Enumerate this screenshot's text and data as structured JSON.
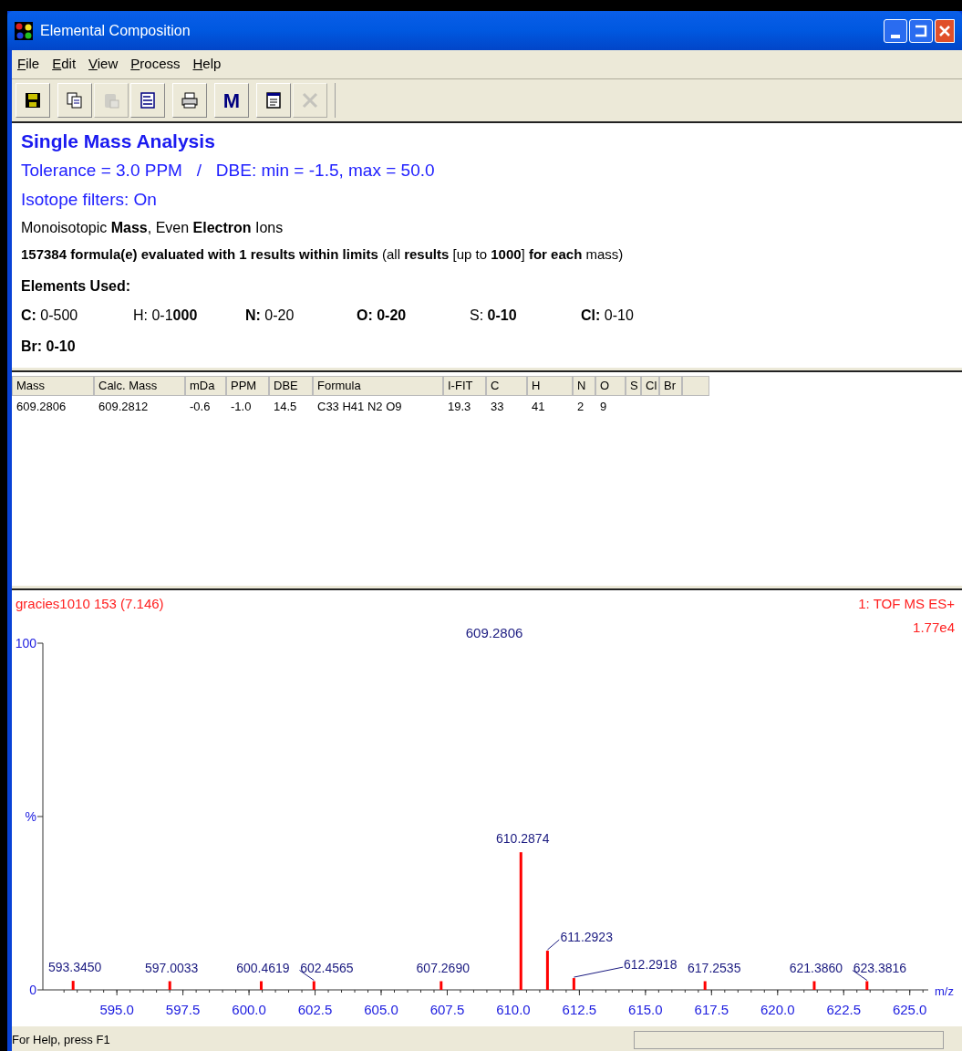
{
  "window": {
    "title": "Elemental Composition"
  },
  "menu": [
    "File",
    "Edit",
    "View",
    "Process",
    "Help"
  ],
  "toolbar": [
    {
      "kind": "save",
      "disabled": false
    },
    {
      "kind": "copy",
      "disabled": false
    },
    {
      "kind": "paste",
      "disabled": true
    },
    {
      "kind": "properties",
      "disabled": false
    },
    {
      "kind": "print",
      "disabled": false
    },
    {
      "kind": "letter",
      "label": "M",
      "disabled": false
    },
    {
      "kind": "document",
      "disabled": false
    },
    {
      "kind": "cross",
      "disabled": true
    }
  ],
  "summary": {
    "title": "Single Mass Analysis",
    "tolerance": "Tolerance = 3.0 PPM   /   DBE: min = -1.5, max = 50.0",
    "isotope": "Isotope filters: On",
    "mode": "Monoisotopic **Mass**, Even **Electron** Ions",
    "evaluated": "**157384 formula(e) evaluated with 1 results within limits** (all **results** [up to **1000**] **for each** mass)",
    "elements_title": "Elements Used:",
    "elements": [
      "**C:** 0-500",
      "H: 0-1**000**",
      "**N:** 0-20",
      "**O: 0-20**",
      "S: **0-10**",
      "**Cl:** 0-10",
      "**Br: 0-10**"
    ]
  },
  "table": {
    "columns": [
      "Mass",
      "Calc. Mass",
      "mDa",
      "PPM",
      "DBE",
      "Formula",
      "I-FIT",
      "C",
      "H",
      "N",
      "O",
      "S",
      "Cl",
      "Br"
    ],
    "rows": [
      [
        "609.2806",
        "609.2812",
        "-0.6",
        "-1.0",
        "14.5",
        "C33 H41 N2 O9",
        "19.3",
        "33",
        "41",
        "2",
        "9",
        "",
        "",
        ""
      ]
    ]
  },
  "spectrum": {
    "sample": "gracies1010 153 (7.146)",
    "scan": "1: TOF MS ES+",
    "intensity": "1.77e4",
    "axis_label": "m/z",
    "base_peak_label": "609.2806",
    "chart_data": {
      "type": "bar",
      "x": [
        593.345,
        597.0033,
        600.4619,
        602.4565,
        607.269,
        610.2874,
        611.2923,
        612.2918,
        617.2535,
        621.386,
        623.3816
      ],
      "values": [
        2.6,
        2.5,
        2.5,
        2.5,
        2.5,
        39.7,
        11.3,
        3.4,
        2.5,
        2.5,
        2.5
      ],
      "annotations": [
        {
          "x": 593.345,
          "y": 2.6,
          "text": "593.3450"
        },
        {
          "x": 597.0033,
          "y": 2.5,
          "text": "597.0033"
        },
        {
          "x": 600.4619,
          "y": 2.5,
          "text": "600.4619"
        },
        {
          "x": 602.4565,
          "y": 2.5,
          "text": "602.4565"
        },
        {
          "x": 607.269,
          "y": 2.5,
          "text": "607.2690"
        },
        {
          "x": 610.2874,
          "y": 39.7,
          "text": "610.2874"
        },
        {
          "x": 611.2923,
          "y": 11.3,
          "text": "611.2923"
        },
        {
          "x": 612.2918,
          "y": 3.4,
          "text": "612.2918"
        },
        {
          "x": 617.2535,
          "y": 2.5,
          "text": "617.2535"
        },
        {
          "x": 621.386,
          "y": 2.5,
          "text": "621.3860"
        },
        {
          "x": 623.3816,
          "y": 2.5,
          "text": "623.3816"
        }
      ],
      "xlim": [
        592.2,
        625.7
      ],
      "ylim": [
        0,
        100
      ],
      "xticks": [
        {
          "value": 595,
          "label": "595.0"
        },
        {
          "value": 597.5,
          "label": "597.5"
        },
        {
          "value": 600,
          "label": "600.0"
        },
        {
          "value": 602.5,
          "label": "602.5"
        },
        {
          "value": 605,
          "label": "605.0"
        },
        {
          "value": 607.5,
          "label": "607.5"
        },
        {
          "value": 610,
          "label": "610.0"
        },
        {
          "value": 612.5,
          "label": "612.5"
        },
        {
          "value": 615,
          "label": "615.0"
        },
        {
          "value": 617.5,
          "label": "617.5"
        },
        {
          "value": 620,
          "label": "620.0"
        },
        {
          "value": 622.5,
          "label": "622.5"
        },
        {
          "value": 625,
          "label": "625.0"
        }
      ],
      "yticks": [
        0,
        {
          "value": 50,
          "label": "%"
        },
        100
      ]
    }
  },
  "status_bar": {
    "text": "For Help, press F1"
  }
}
